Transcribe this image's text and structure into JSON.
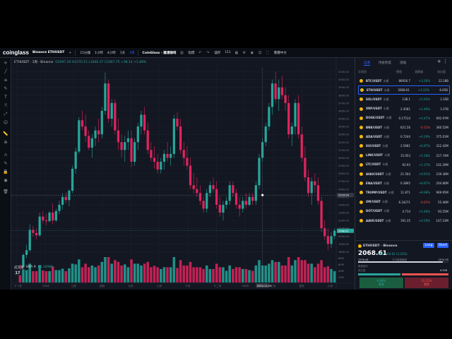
{
  "topbar": {
    "logo": "coinglass",
    "symbol": "Binance ETHUSDT",
    "intervals": [
      "15分鐘",
      "1小時",
      "4小時",
      "1天",
      "1周"
    ],
    "active_interval": "1周",
    "site_link": "CoinGlass - 雜湯咖啡",
    "controls": [
      "指標",
      "儲存",
      "111"
    ],
    "language": "繁體中文"
  },
  "chart": {
    "legend_symbol": "ETHUSDT · 1周 · Binance",
    "legend_ohlc": "O2097.29 H2270.15 L1840.37 C2067.75 +38.14 +1.88%",
    "volume_label": "成交量",
    "volume_ma": "SMA 9",
    "volume_value": "86.1498K",
    "current_price_tag": "2068.61",
    "crosshair_price": "2524.09",
    "crosshair_time": "2024-11-04",
    "y_ticks": [
      "4100.00",
      "4000.00",
      "3900.00",
      "3800.00",
      "3700.00",
      "3600.00",
      "3500.00",
      "3400.00",
      "3300.00",
      "3200.00",
      "3100.00",
      "3000.00",
      "2900.00",
      "2800.00",
      "2700.00",
      "2600.00",
      "2500.00",
      "2400.00",
      "2300.00",
      "2200.00",
      "2100.00",
      "2000.00",
      "1900.00",
      "1800.00"
    ],
    "vol_ticks": [
      "80M",
      "60M",
      "40M",
      "20M"
    ],
    "x_ticks": [
      "十一月",
      "2024",
      "三月",
      "四月",
      "七月",
      "八月",
      "十月",
      "十二月",
      "2025",
      "三月",
      "四月",
      "六月"
    ],
    "colors": {
      "up": "#26a69a",
      "down": "#e0245e",
      "bg": "#131722",
      "grid": "#1e222d"
    }
  },
  "chart_data": {
    "type": "candlestick",
    "title": "ETHUSDT · 1周 · Binance",
    "ylim": [
      1750,
      4150
    ],
    "candles": [
      [
        1610,
        1640,
        1560,
        1600
      ],
      [
        1600,
        1780,
        1590,
        1760
      ],
      [
        1760,
        1890,
        1720,
        1820
      ],
      [
        1820,
        2150,
        1800,
        2080
      ],
      [
        2080,
        2130,
        1990,
        2040
      ],
      [
        2040,
        2100,
        1960,
        2010
      ],
      [
        2010,
        2300,
        1990,
        2250
      ],
      [
        2250,
        2320,
        2160,
        2200
      ],
      [
        2200,
        2280,
        2140,
        2190
      ],
      [
        2190,
        2320,
        2180,
        2300
      ],
      [
        2300,
        2420,
        2150,
        2200
      ],
      [
        2200,
        2350,
        2180,
        2320
      ],
      [
        2320,
        2450,
        2280,
        2400
      ],
      [
        2400,
        2550,
        2340,
        2500
      ],
      [
        2500,
        2560,
        2420,
        2460
      ],
      [
        2460,
        2600,
        2380,
        2580
      ],
      [
        2580,
        2900,
        2550,
        2860
      ],
      [
        2860,
        3130,
        2800,
        3080
      ],
      [
        3080,
        3520,
        3050,
        3480
      ],
      [
        3480,
        3600,
        3350,
        3400
      ],
      [
        3400,
        3550,
        3200,
        3280
      ],
      [
        3280,
        3350,
        3100,
        3130
      ],
      [
        3130,
        3300,
        3000,
        3250
      ],
      [
        3250,
        3400,
        3150,
        3350
      ],
      [
        3350,
        3500,
        3200,
        3300
      ],
      [
        3300,
        3650,
        3250,
        3600
      ],
      [
        3600,
        4090,
        3550,
        3950
      ],
      [
        3950,
        4000,
        3450,
        3500
      ],
      [
        3500,
        3750,
        3400,
        3700
      ],
      [
        3700,
        3750,
        3300,
        3350
      ],
      [
        3350,
        3500,
        3100,
        3200
      ],
      [
        3200,
        3300,
        3000,
        3100
      ],
      [
        3100,
        3280,
        2950,
        3200
      ],
      [
        3200,
        3350,
        3100,
        3250
      ],
      [
        3250,
        3350,
        2880,
        2950
      ],
      [
        2950,
        3250,
        2900,
        3200
      ],
      [
        3200,
        3450,
        3100,
        3400
      ],
      [
        3400,
        3600,
        3300,
        3550
      ],
      [
        3550,
        3650,
        3300,
        3350
      ],
      [
        3350,
        3450,
        3050,
        3100
      ],
      [
        3100,
        3200,
        2950,
        3000
      ],
      [
        3000,
        3150,
        2860,
        2950
      ],
      [
        2950,
        3050,
        2800,
        2850
      ],
      [
        2850,
        3000,
        2800,
        2950
      ],
      [
        2950,
        3100,
        2850,
        3050
      ],
      [
        3050,
        3200,
        2950,
        3000
      ],
      [
        3000,
        3150,
        2900,
        3050
      ],
      [
        3050,
        3550,
        3000,
        3500
      ],
      [
        3500,
        3580,
        3350,
        3400
      ],
      [
        3400,
        3500,
        3050,
        3100
      ],
      [
        3100,
        3200,
        2900,
        3000
      ],
      [
        3000,
        3150,
        2850,
        2900
      ],
      [
        2900,
        3000,
        2600,
        2650
      ],
      [
        2650,
        2800,
        2550,
        2600
      ],
      [
        2600,
        2750,
        2500,
        2550
      ],
      [
        2550,
        2650,
        2400,
        2450
      ],
      [
        2450,
        2500,
        2300,
        2350
      ],
      [
        2350,
        2600,
        2300,
        2550
      ],
      [
        2550,
        2700,
        2500,
        2650
      ],
      [
        2650,
        2750,
        2550,
        2600
      ],
      [
        2600,
        2700,
        2350,
        2400
      ],
      [
        2400,
        2500,
        2250,
        2300
      ],
      [
        2300,
        2450,
        2200,
        2400
      ],
      [
        2400,
        2500,
        2350,
        2450
      ],
      [
        2450,
        2700,
        2400,
        2650
      ],
      [
        2650,
        2700,
        2500,
        2550
      ],
      [
        2550,
        2600,
        2350,
        2400
      ],
      [
        2400,
        2500,
        2250,
        2350
      ],
      [
        2350,
        2500,
        2300,
        2450
      ],
      [
        2450,
        2550,
        2350,
        2400
      ],
      [
        2400,
        2550,
        2380,
        2500
      ],
      [
        2500,
        2550,
        2400,
        2450
      ],
      [
        2450,
        2700,
        2400,
        2650
      ],
      [
        2650,
        3050,
        2600,
        3000
      ],
      [
        3000,
        3250,
        2950,
        3200
      ],
      [
        3200,
        3450,
        3150,
        3400
      ],
      [
        3400,
        3700,
        3350,
        3650
      ],
      [
        3650,
        4000,
        3550,
        3950
      ],
      [
        3950,
        4100,
        3700,
        3750
      ],
      [
        3750,
        4000,
        3600,
        3900
      ],
      [
        3900,
        4050,
        3750,
        3800
      ],
      [
        3800,
        3900,
        3600,
        3700
      ],
      [
        3700,
        3800,
        3250,
        3300
      ],
      [
        3300,
        3450,
        3150,
        3400
      ],
      [
        3400,
        3750,
        3300,
        3700
      ],
      [
        3700,
        3800,
        3250,
        3300
      ],
      [
        3300,
        3400,
        2950,
        3000
      ],
      [
        3000,
        3150,
        2700,
        2750
      ],
      [
        2750,
        2850,
        2500,
        2550
      ],
      [
        2550,
        2750,
        2400,
        2700
      ],
      [
        2700,
        2800,
        2550,
        2650
      ],
      [
        2650,
        2750,
        2400,
        2450
      ],
      [
        2450,
        2500,
        2050,
        2100
      ],
      [
        2100,
        2200,
        1950,
        2000
      ],
      [
        2000,
        2100,
        1820,
        1900
      ],
      [
        1900,
        2050,
        1850,
        2000
      ],
      [
        2000,
        2100,
        1960,
        2068
      ]
    ],
    "volume_max": 90
  },
  "watchlist": {
    "tabs": [
      "自選",
      "持倉熱度",
      "漲幅"
    ],
    "active_tab": "自選",
    "headers": [
      "交易對",
      "價格",
      "漲跌幅",
      "成交量"
    ],
    "rows": [
      {
        "sym": "BTC/USDT",
        "ex": "永續",
        "price": "86926.7",
        "chg": "+3.26%",
        "vol": "12.18B",
        "up": true
      },
      {
        "sym": "ETH/USDT",
        "ex": "永續",
        "price": "2068.61",
        "chg": "+3.22%",
        "vol": "6.65B",
        "up": true,
        "selected": true
      },
      {
        "sym": "SOL/USDT",
        "ex": "永續",
        "price": "138.1",
        "chg": "+5.92%",
        "vol": "2.35B",
        "up": true
      },
      {
        "sym": "XRP/USDT",
        "ex": "永續",
        "price": "2.4581",
        "chg": "+2.49%",
        "vol": "1.07B",
        "up": true
      },
      {
        "sym": "DOGE/USDT",
        "ex": "永續",
        "price": "0.17514",
        "chg": "+4.47%",
        "vol": "692.97M",
        "up": true
      },
      {
        "sym": "BNB/USDT",
        "ex": "永續",
        "price": "621.56",
        "chg": "-0.11%",
        "vol": "360.52M",
        "up": false
      },
      {
        "sym": "ADA/USDT",
        "ex": "永續",
        "price": "0.7244",
        "chg": "+4.29%",
        "vol": "375.01M",
        "up": true
      },
      {
        "sym": "SUI/USDT",
        "ex": "永續",
        "price": "2.5681",
        "chg": "+6.87%",
        "vol": "312.42M",
        "up": true
      },
      {
        "sym": "LINK/USDT",
        "ex": "永續",
        "price": "15.053",
        "chg": "+5.18%",
        "vol": "217.74M",
        "up": true
      },
      {
        "sym": "LTC/USDT",
        "ex": "永續",
        "price": "92.93",
        "chg": "+1.37%",
        "vol": "161.29M",
        "up": true
      },
      {
        "sym": "AVAX/USDT",
        "ex": "永續",
        "price": "21.564",
        "chg": "+9.91%",
        "vol": "239.36M",
        "up": true
      },
      {
        "sym": "ENA/USDT",
        "ex": "永續",
        "price": "0.3895",
        "chg": "+8.87%",
        "vol": "204.80M",
        "up": true
      },
      {
        "sym": "TRUMP/USDT",
        "ex": "永續",
        "price": "11.871",
        "chg": "+8.98%",
        "vol": "969.95M",
        "up": true
      },
      {
        "sym": "OM/USDT",
        "ex": "永續",
        "price": "6.34271",
        "chg": "-0.61%",
        "vol": "55.46M",
        "up": false
      },
      {
        "sym": "DOT/USDT",
        "ex": "永續",
        "price": "4.714",
        "chg": "+5.40%",
        "vol": "93.55M",
        "up": true
      },
      {
        "sym": "AAVE/USDT",
        "ex": "永續",
        "price": "191.35",
        "chg": "+4.59%",
        "vol": "147.23M",
        "up": true
      }
    ]
  },
  "detail": {
    "symbol": "ETHUSDT · Binance",
    "long_label": "Long",
    "short_label": "Short",
    "price": "2068.61",
    "price_sub": "USD +64.62 (3.22%)",
    "range_low": "1976.46",
    "range_mid": "今日價格範圍",
    "range_high": "2074.55",
    "sentiment_label": "數據統計",
    "vol_label": "成交量",
    "vol_value": "6.65B",
    "bull_pct": "9.68%",
    "bull_label": "看漲",
    "bear_pct": "31.25%",
    "bear_label": "看跌",
    "colors": {
      "long": "#2962ff",
      "short": "#2962ff",
      "bull": "#1b5e3f",
      "bear": "#6b1f2e"
    }
  }
}
